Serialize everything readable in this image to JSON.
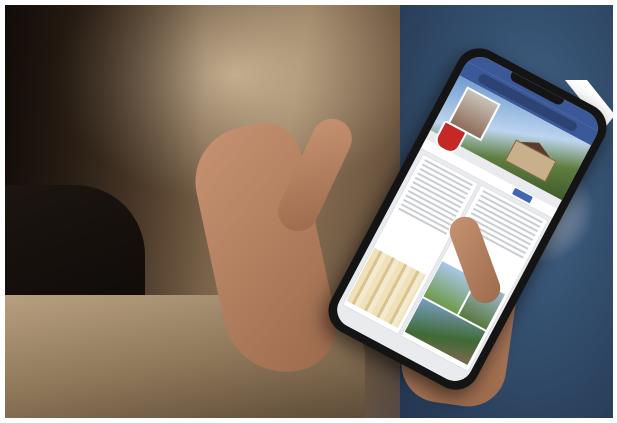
{
  "scene": {
    "description_colors": {
      "background": "#5a4430",
      "jeans": "#34506f",
      "skin": "#c79372",
      "facebook_blue": "#3b5998",
      "chevron": "#ffffff"
    },
    "icons": [
      "chevron-right-icon"
    ]
  }
}
